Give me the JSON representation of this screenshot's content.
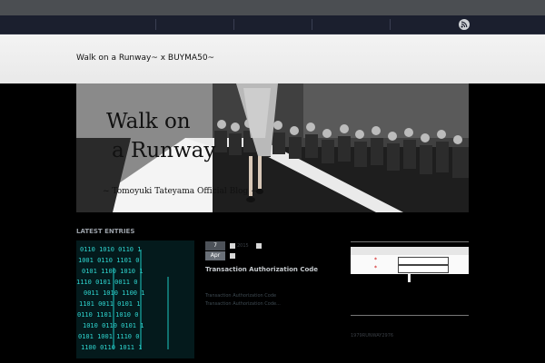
{
  "site": {
    "title": "Walk on a Runway~ x BUYMA50~"
  },
  "banner": {
    "title_line1": "Walk on",
    "title_line2": "a Runway",
    "subtitle": "~ Tomoyuki Tateyama Official Blog ~"
  },
  "latest": {
    "heading": "LATEST ENTRIES",
    "date_day": "7",
    "date_month": "Apr",
    "meta_year": "2015",
    "title": "Transaction Authorization Code",
    "lines": [
      "Transaction Authorization Code",
      "Transaction Authorization Code..."
    ]
  },
  "widget": {
    "required_mark": "*"
  },
  "footer": {
    "text": "1979RUNWAY2976"
  },
  "colors": {
    "nav": "#1b1f2e",
    "header": "#f0f0f0",
    "body": "#000000",
    "thumb_glow": "#2fd6d0"
  }
}
